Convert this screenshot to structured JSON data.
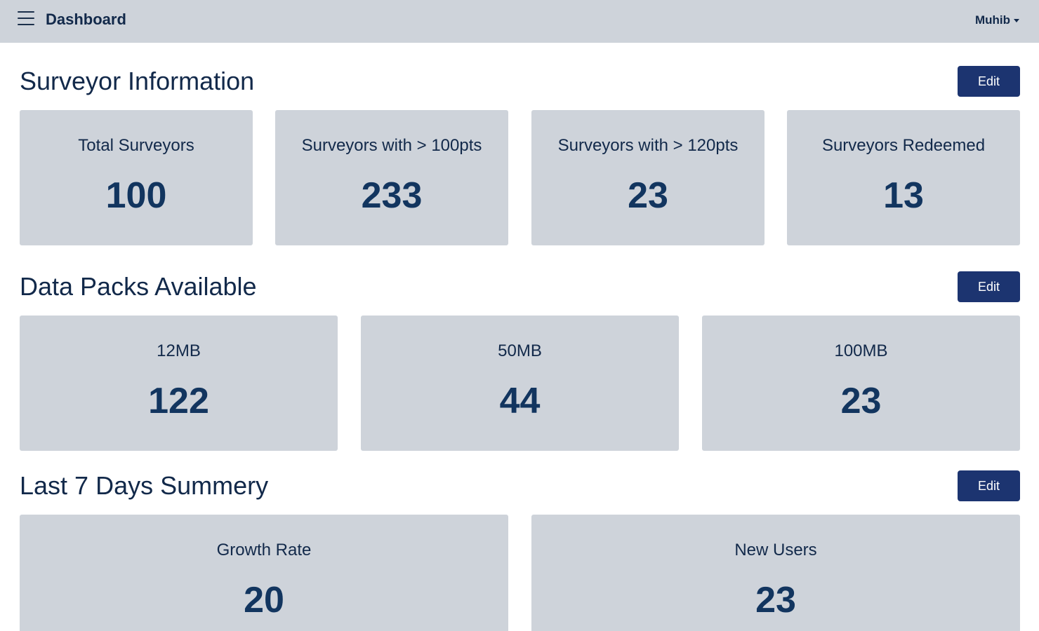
{
  "navbar": {
    "brand": "Dashboard",
    "user": "Muhib"
  },
  "surveyor_info": {
    "title": "Surveyor Information",
    "edit_label": "Edit",
    "cards": [
      {
        "label": "Total Surveyors",
        "value": "100"
      },
      {
        "label": "Surveyors with > 100pts",
        "value": "233"
      },
      {
        "label": "Surveyors with > 120pts",
        "value": "23"
      },
      {
        "label": "Surveyors Redeemed",
        "value": "13"
      }
    ]
  },
  "data_packs": {
    "title": "Data Packs Available",
    "edit_label": "Edit",
    "cards": [
      {
        "label": "12MB",
        "value": "122"
      },
      {
        "label": "50MB",
        "value": "44"
      },
      {
        "label": "100MB",
        "value": "23"
      }
    ]
  },
  "last_7_days": {
    "title": "Last 7 Days Summery",
    "edit_label": "Edit",
    "cards": [
      {
        "label": "Growth Rate",
        "value": "20"
      },
      {
        "label": "New Users",
        "value": "23"
      }
    ]
  },
  "colors": {
    "navbar_bg": "#ced3da",
    "card_bg": "#ced3da",
    "button_bg": "#1c3470",
    "text_primary": "#12294a"
  }
}
